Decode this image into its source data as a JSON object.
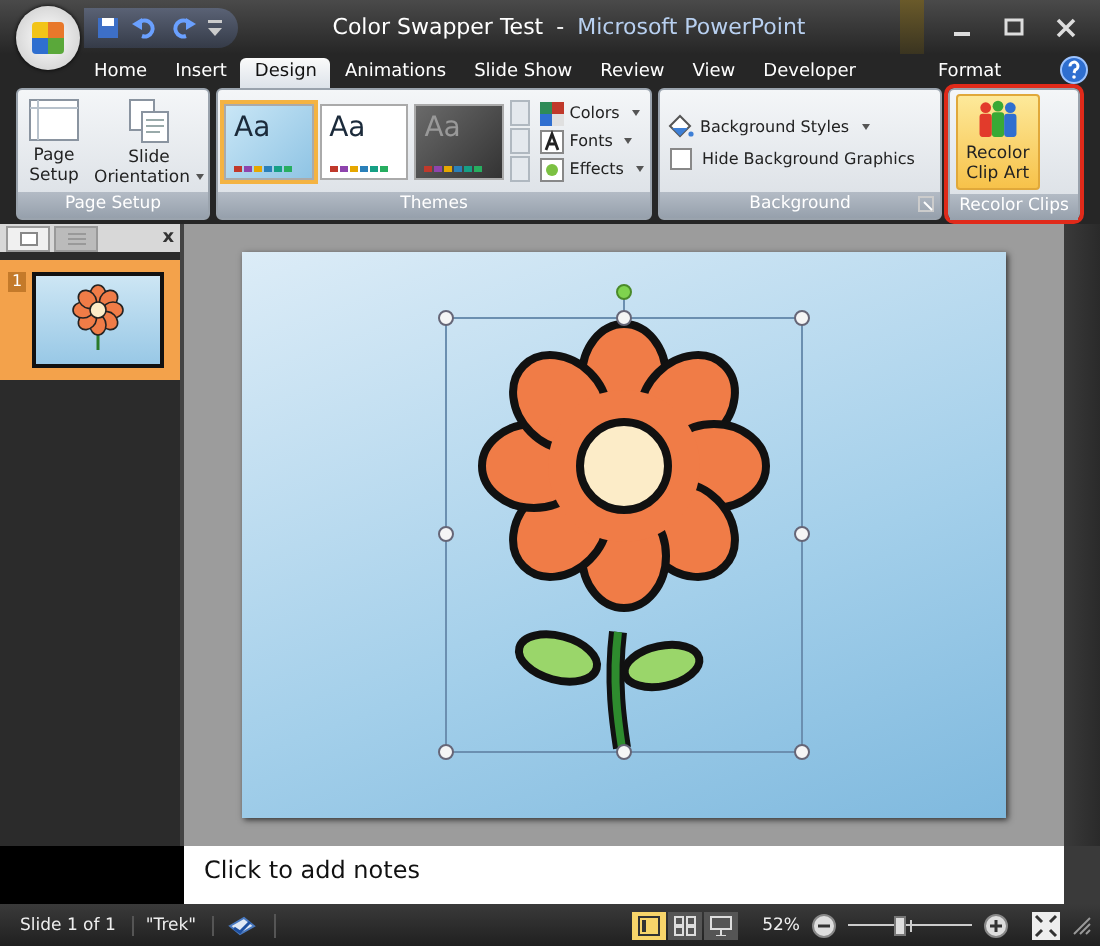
{
  "window": {
    "document": "Color Swapper Test",
    "separator": "-",
    "app": "Microsoft PowerPoint"
  },
  "tabs": [
    {
      "label": "Home",
      "selected": false,
      "kind": "normal"
    },
    {
      "label": "Insert",
      "selected": false,
      "kind": "normal"
    },
    {
      "label": "Design",
      "selected": true,
      "kind": "normal"
    },
    {
      "label": "Animations",
      "selected": false,
      "kind": "normal"
    },
    {
      "label": "Slide Show",
      "selected": false,
      "kind": "normal"
    },
    {
      "label": "Review",
      "selected": false,
      "kind": "normal"
    },
    {
      "label": "View",
      "selected": false,
      "kind": "normal"
    },
    {
      "label": "Developer",
      "selected": false,
      "kind": "normal"
    },
    {
      "label": "Format",
      "selected": false,
      "kind": "contextual"
    }
  ],
  "ribbon": {
    "page_setup": {
      "label": "Page Setup",
      "buttons": [
        {
          "label": "Page\nSetup",
          "dropdown": false
        },
        {
          "label": "Slide\nOrientation",
          "dropdown": true
        }
      ]
    },
    "themes": {
      "label": "Themes",
      "items": [
        {
          "sample": "Aa",
          "selected": true,
          "kind": "blue"
        },
        {
          "sample": "Aa",
          "selected": false,
          "kind": "white"
        },
        {
          "sample": "Aa",
          "selected": false,
          "kind": "dark"
        }
      ],
      "options": [
        {
          "label": "Colors",
          "kind": "colors"
        },
        {
          "label": "Fonts",
          "kind": "fonts"
        },
        {
          "label": "Effects",
          "kind": "effects"
        }
      ]
    },
    "background": {
      "label": "Background",
      "styles": "Background Styles",
      "hide": {
        "label": "Hide Background Graphics",
        "checked": false
      }
    },
    "recolor": {
      "label": "Recolor Clips",
      "button": "Recolor\nClip Art",
      "highlighted": true
    }
  },
  "slides_panel": {
    "close": "x",
    "slides": [
      {
        "number": "1",
        "selected": true
      }
    ]
  },
  "notes": {
    "placeholder": "Click to add notes"
  },
  "status_bar": {
    "slide": "Slide 1 of 1",
    "theme": "\"Trek\"",
    "zoom": "52%",
    "zoom_slider": {
      "level": 0.42
    },
    "views": [
      {
        "kind": "normal",
        "selected": true
      },
      {
        "kind": "sorter",
        "selected": false
      },
      {
        "kind": "show",
        "selected": false
      }
    ]
  }
}
